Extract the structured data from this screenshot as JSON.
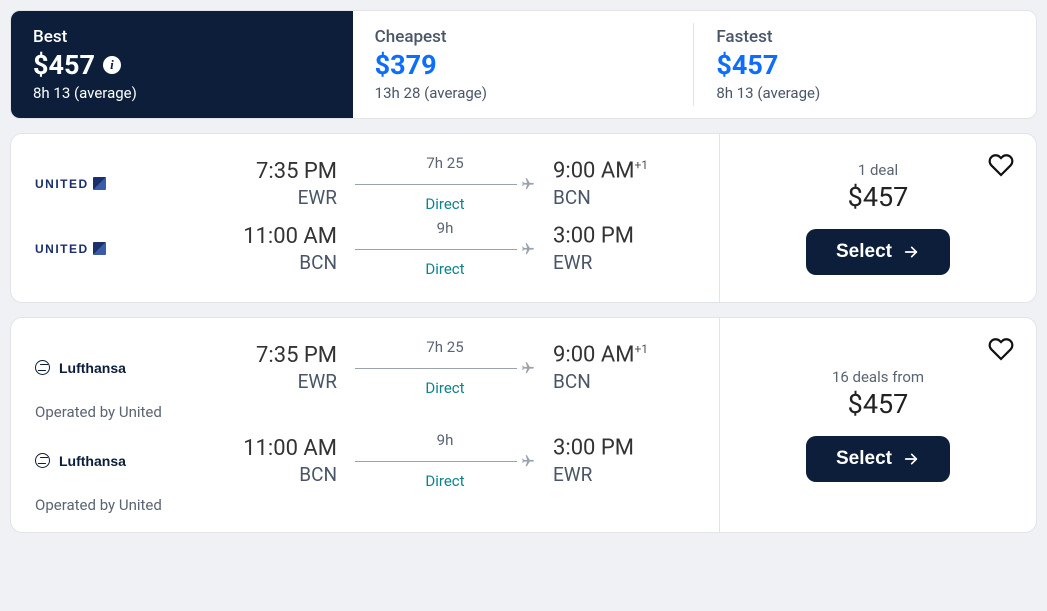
{
  "sort_tabs": [
    {
      "label": "Best",
      "price": "$457",
      "meta": "8h 13 (average)",
      "active": true,
      "has_info": true
    },
    {
      "label": "Cheapest",
      "price": "$379",
      "meta": "13h 28 (average)",
      "active": false,
      "has_info": false
    },
    {
      "label": "Fastest",
      "price": "$457",
      "meta": "8h 13 (average)",
      "active": false,
      "has_info": false
    }
  ],
  "select_label": "Select",
  "flights": [
    {
      "deals_label": "1 deal",
      "price": "$457",
      "legs": [
        {
          "airline": "united",
          "dep_time": "7:35 PM",
          "dep_airport": "EWR",
          "duration": "7h 25",
          "stops": "Direct",
          "arr_time": "9:00 AM",
          "arr_sup": "+1",
          "arr_airport": "BCN",
          "operated_by": ""
        },
        {
          "airline": "united",
          "dep_time": "11:00 AM",
          "dep_airport": "BCN",
          "duration": "9h",
          "stops": "Direct",
          "arr_time": "3:00 PM",
          "arr_sup": "",
          "arr_airport": "EWR",
          "operated_by": ""
        }
      ]
    },
    {
      "deals_label": "16 deals from",
      "price": "$457",
      "legs": [
        {
          "airline": "lufthansa",
          "dep_time": "7:35 PM",
          "dep_airport": "EWR",
          "duration": "7h 25",
          "stops": "Direct",
          "arr_time": "9:00 AM",
          "arr_sup": "+1",
          "arr_airport": "BCN",
          "operated_by": "Operated by United"
        },
        {
          "airline": "lufthansa",
          "dep_time": "11:00 AM",
          "dep_airport": "BCN",
          "duration": "9h",
          "stops": "Direct",
          "arr_time": "3:00 PM",
          "arr_sup": "",
          "arr_airport": "EWR",
          "operated_by": "Operated by United"
        }
      ]
    }
  ]
}
